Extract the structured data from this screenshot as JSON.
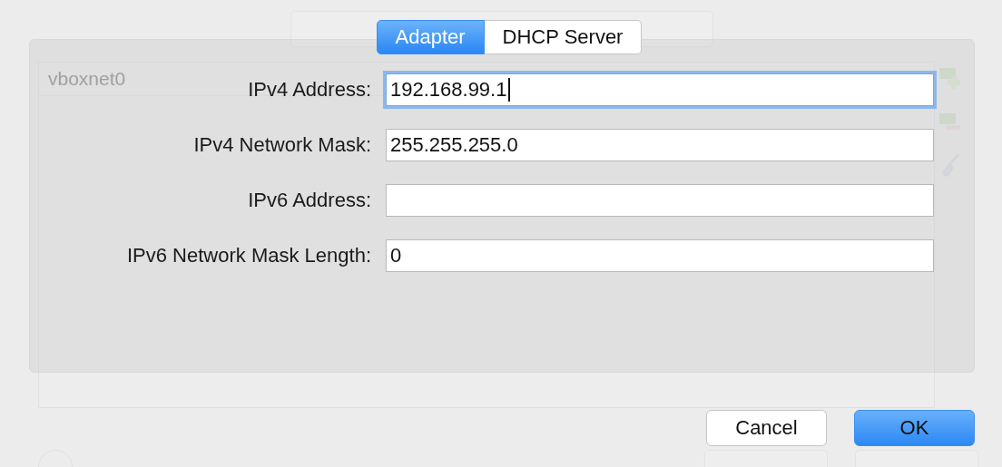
{
  "background": {
    "network_list": [
      "vboxnet0"
    ]
  },
  "tabs": [
    {
      "label": "Adapter",
      "selected": true
    },
    {
      "label": "DHCP Server",
      "selected": false
    }
  ],
  "fields": [
    {
      "label": "IPv4 Address:",
      "value": "192.168.99.1",
      "focused": true
    },
    {
      "label": "IPv4 Network Mask:",
      "value": "255.255.255.0",
      "focused": false
    },
    {
      "label": "IPv6 Address:",
      "focused": false
    },
    {
      "label": "IPv6 Network Mask Length:",
      "value": "0",
      "focused": false
    }
  ],
  "buttons": [
    {
      "label": "Cancel",
      "kind": "default"
    },
    {
      "label": "OK",
      "kind": "primary"
    }
  ]
}
